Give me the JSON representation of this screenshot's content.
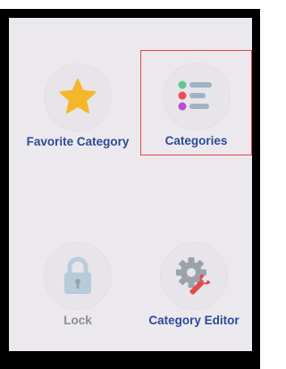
{
  "menu": {
    "items": [
      {
        "label": "Favorite Category",
        "icon": "star-icon",
        "state": "normal"
      },
      {
        "label": "Categories",
        "icon": "category-list-icon",
        "state": "selected"
      },
      {
        "label": "Lock",
        "icon": "lock-icon",
        "state": "disabled"
      },
      {
        "label": "Category Editor",
        "icon": "gear-wrench-icon",
        "state": "normal"
      }
    ]
  },
  "colors": {
    "screen_bg": "#ece9ee",
    "label": "#2c4b97",
    "label_disabled": "#8e8e8e",
    "selection_border": "#e04848",
    "star": "#f5b72a",
    "lock": "#b8cbd8",
    "gear": "#9aa3ab",
    "wrench": "#e24b4b",
    "dot_green": "#5cc98c",
    "dot_red": "#ef4d56",
    "dot_purple": "#b34fd6",
    "line_slate": "#9fb3c4"
  }
}
